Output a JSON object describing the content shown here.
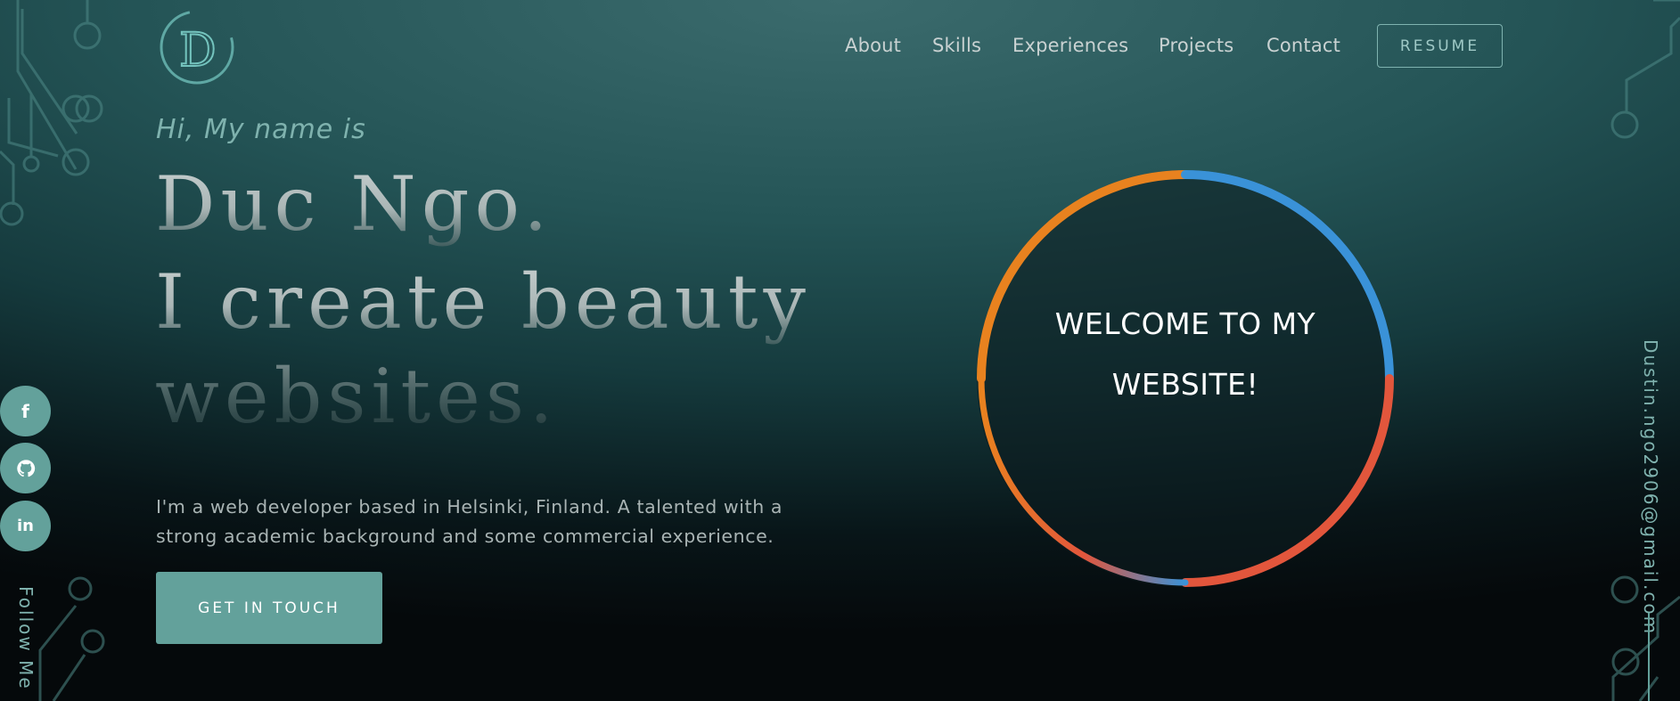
{
  "nav": {
    "links": [
      "About",
      "Skills",
      "Experiences",
      "Projects",
      "Contact"
    ],
    "resume_label": "RESUME"
  },
  "logo": {
    "letter": "D"
  },
  "hero": {
    "greeting": "Hi, My name is",
    "name": "Duc Ngo.",
    "line2": "I create beauty",
    "line3": "websites.",
    "bio": "I'm a web developer based in Helsinki, Finland. A talented with a strong academic background and some commercial experience.",
    "cta_label": "GET IN TOUCH"
  },
  "welcome": {
    "text_line1": "WELCOME TO MY",
    "text_line2": "WEBSITE!"
  },
  "social": {
    "items": [
      {
        "icon": "facebook-icon",
        "glyph": "f"
      },
      {
        "icon": "github-icon",
        "glyph": "⌥"
      },
      {
        "icon": "linkedin-icon",
        "glyph": "in"
      }
    ],
    "follow_label": "Follow Me"
  },
  "contact": {
    "email": "Dustin.ngo2906@gmail.com"
  },
  "colors": {
    "accent": "#63a19b",
    "ring_orange": "#e8821f",
    "ring_blue": "#3a92d8",
    "ring_red": "#e2563c"
  }
}
